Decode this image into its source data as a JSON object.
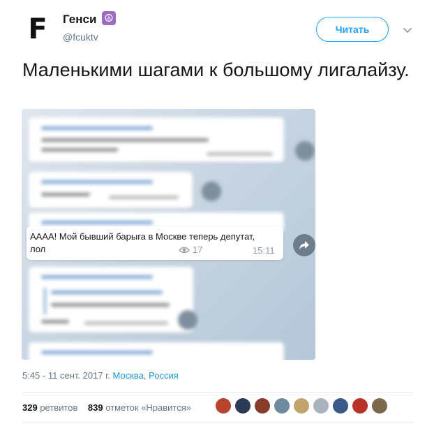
{
  "author": {
    "avatar_letter": "F",
    "name": "Генси",
    "emoji": "☮",
    "handle": "@fcuktv"
  },
  "follow_button": "Читать",
  "tweet_text": "Маленькими шагами к большому лигалайзу.",
  "media": {
    "message_text": "АААА! Мой бывший барыга в Москве теперь депутат, лол",
    "views": "17",
    "time": "15:11"
  },
  "meta": {
    "timestamp": "5:45 - 11 сент. 2017 г.",
    "location_city": "Москва",
    "location_sep": ", ",
    "location_country": "Россия"
  },
  "stats": {
    "retweets_count": "329",
    "retweets_label": "ретвитов",
    "likes_count": "839",
    "likes_label": "отметок «Нравится»"
  },
  "likers": [
    {
      "color": "#b8432f"
    },
    {
      "color": "#2a3a57"
    },
    {
      "color": "#8a3c2c"
    },
    {
      "color": "#6f8a9c"
    },
    {
      "color": "#c1a36d"
    },
    {
      "color": "#a9b3bd"
    },
    {
      "color": "#3a5a8a"
    },
    {
      "color": "#b8322a"
    },
    {
      "color": "#7d6a4c"
    }
  ],
  "colors": {
    "accent": "#1da1f2",
    "link": "#1b95e0",
    "secondary_text": "#657786"
  }
}
